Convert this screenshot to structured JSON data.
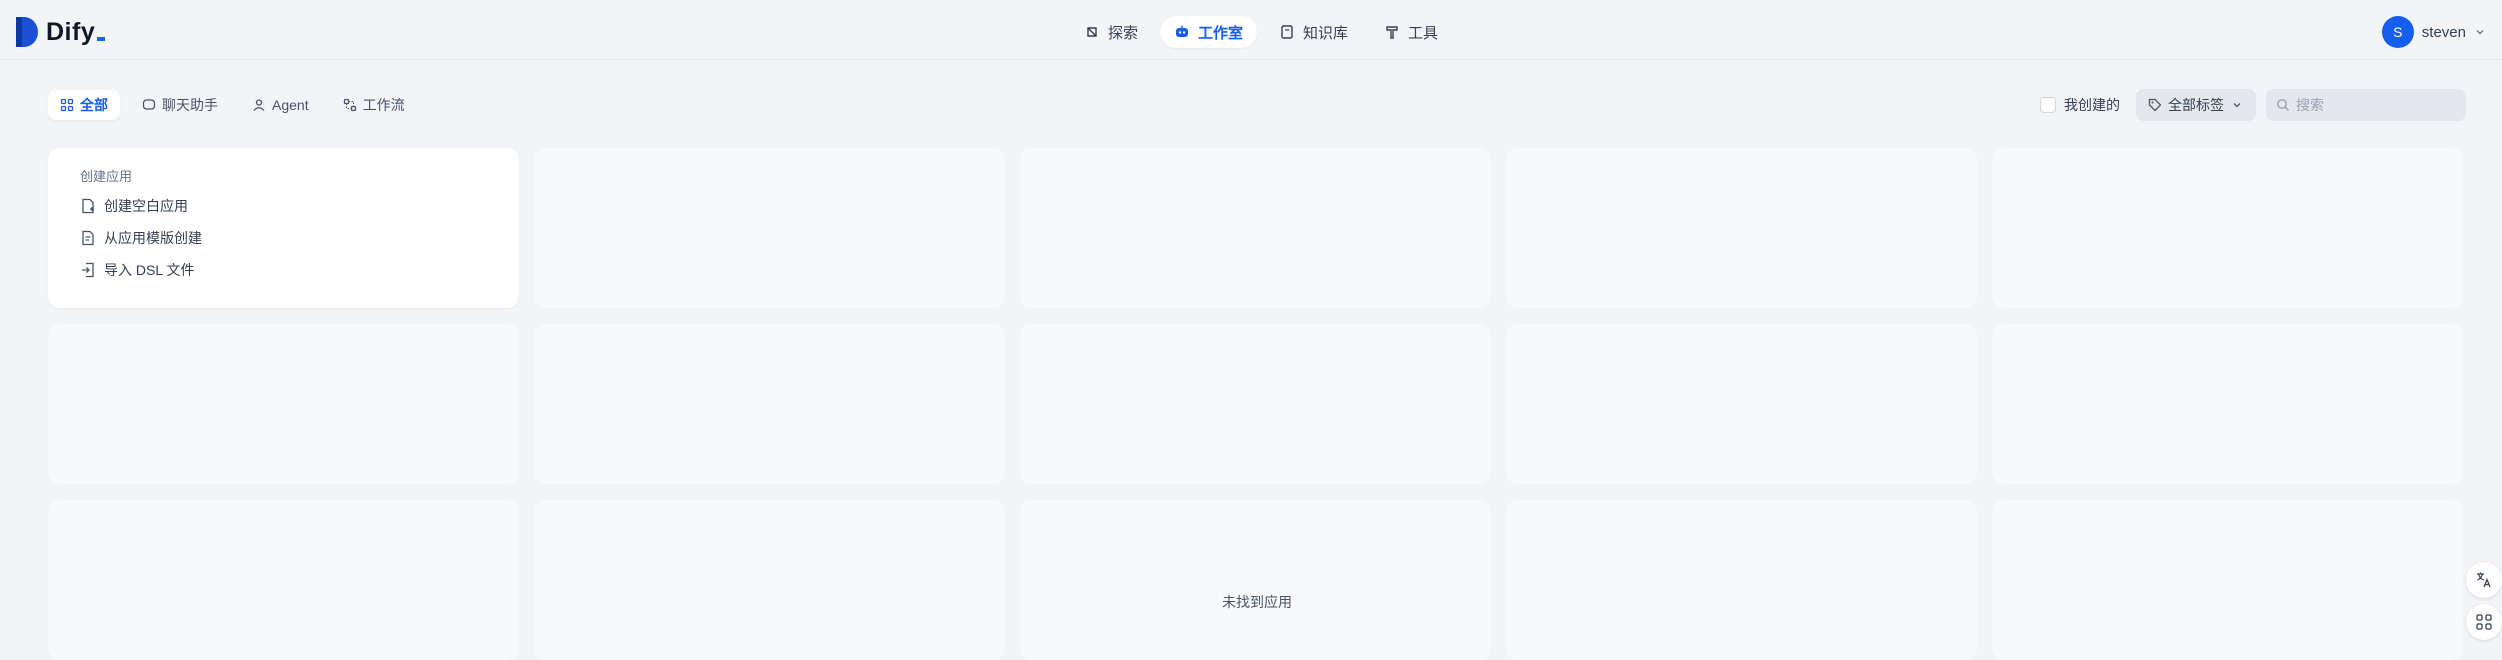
{
  "app": {
    "name": "Dify"
  },
  "nav": {
    "items": [
      {
        "label": "探索",
        "icon": "compass-icon"
      },
      {
        "label": "工作室",
        "icon": "robot-icon",
        "active": true
      },
      {
        "label": "知识库",
        "icon": "book-icon"
      },
      {
        "label": "工具",
        "icon": "hammer-icon"
      }
    ]
  },
  "user": {
    "initial": "S",
    "name": "steven"
  },
  "filters": {
    "tabs": [
      {
        "label": "全部",
        "icon": "grid-icon",
        "active": true
      },
      {
        "label": "聊天助手",
        "icon": "chat-icon"
      },
      {
        "label": "Agent",
        "icon": "agent-icon"
      },
      {
        "label": "工作流",
        "icon": "workflow-icon"
      }
    ],
    "created_by_me": "我创建的",
    "tags": "全部标签",
    "search_placeholder": "搜索"
  },
  "create_card": {
    "title": "创建应用",
    "items": [
      "创建空白应用",
      "从应用模版创建",
      "导入 DSL 文件"
    ]
  },
  "empty_text": "未找到应用",
  "colors": {
    "accent": "#155eef",
    "background": "#f2f4f7"
  }
}
